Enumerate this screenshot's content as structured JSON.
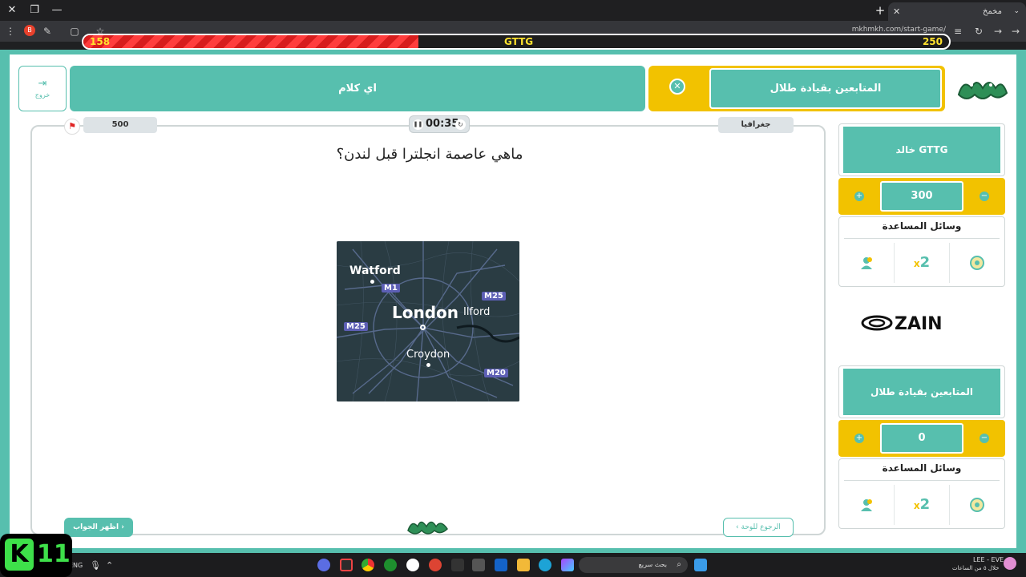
{
  "browser": {
    "tab_title": "مخمخ",
    "url": "mkhmkh.com/start-game/",
    "ext_badge": "B"
  },
  "vote_bar": {
    "left_value": "158",
    "center_label": "GTTG",
    "right_value": "250",
    "left_fraction": 0.387
  },
  "header": {
    "exit_label": "خروج",
    "team_a_name": "اي كلام",
    "active_team_name": "المتابعين بقيادة طلال",
    "brand_logo": "مخمخ"
  },
  "question": {
    "points": "500",
    "timer": "00:35",
    "category": "جغرافيا",
    "text": "ماهي عاصمة انجلترا قبل لندن؟",
    "show_answer_label": "اظهر الجواب",
    "back_to_board_label": "الرجوع للوحة",
    "map_labels": {
      "watford": "Watford",
      "london": "London",
      "ilford": "Ilford",
      "croydon": "Croydon",
      "m1": "M1",
      "m25_left": "M25",
      "m25_right": "M25",
      "m20": "M20"
    }
  },
  "teams": [
    {
      "name": "خالد GTTG",
      "score": "300",
      "aids_title": "وسائل المساعدة",
      "aids": [
        "call-friend-icon",
        "double-points-icon",
        "hole-icon"
      ],
      "double_label": "2"
    },
    {
      "name": "المتابعين بقيادة طلال",
      "score": "0",
      "aids_title": "وسائل المساعدة",
      "aids": [
        "call-friend-icon",
        "double-points-icon",
        "hole-icon"
      ],
      "double_label": "2"
    }
  ],
  "sponsor": "ZAIN",
  "taskbar": {
    "search_placeholder": "بحث سريع",
    "lang": "ENG",
    "user_line": "LEE - EVE",
    "user_sub": "خلال ٥ من الساعات"
  },
  "overlay_badge": {
    "letter": "K",
    "number": "11"
  }
}
